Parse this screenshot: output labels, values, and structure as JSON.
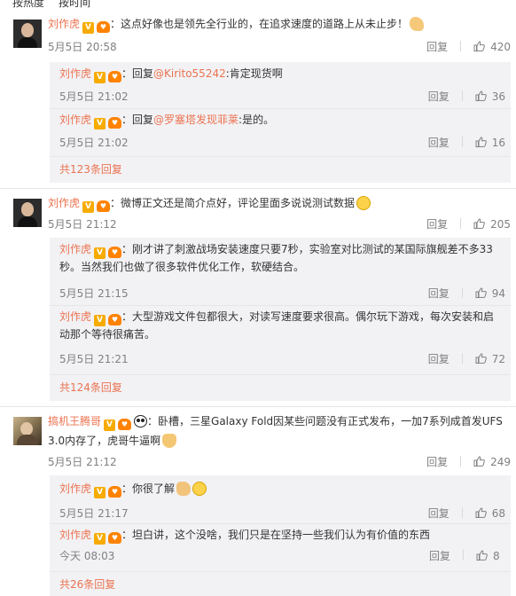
{
  "sort": {
    "hot": "按热度",
    "time": "按时间"
  },
  "actions": {
    "reply": "回复"
  },
  "comments": [
    {
      "user": "刘作虎",
      "fan": "♥",
      "text": "：这点好像也是领先全行业的，在追求速度的道路上从未止步！",
      "emoji": "flexed-arm-emoji",
      "time": "5月5日 20:58",
      "likes": "420",
      "replies": [
        {
          "user": "刘作虎",
          "fan": "♥",
          "prefix": "：回复",
          "mention": "@Kirito55242",
          "text": ":肯定现货啊",
          "time": "5月5日 21:02",
          "likes": "36"
        },
        {
          "user": "刘作虎",
          "fan": "♥",
          "prefix": "：回复",
          "mention": "@罗塞塔发现菲莱",
          "text": ":是的。",
          "time": "5月5日 21:02",
          "likes": "16"
        }
      ],
      "more": "共123条回复"
    },
    {
      "user": "刘作虎",
      "fan": "♥",
      "text": "：微博正文还是简介点好，评论里面多说说测试数据",
      "emoji": "grin-emoji",
      "time": "5月5日 21:12",
      "likes": "205",
      "replies": [
        {
          "user": "刘作虎",
          "fan": "♥",
          "text1": "：刚才讲了刺激战场安装速度只要7秒，实验室对比测试的某国际旗舰差不多33",
          "text2": "秒。当然我们也做了很多软件优化工作，软硬结合。",
          "time": "5月5日 21:15",
          "likes": "94"
        },
        {
          "user": "刘作虎",
          "fan": "♥",
          "text1": "：大型游戏文件包都很大，对读写速度要求很高。偶尔玩下游戏，每次安装和启",
          "text2": "动那个等待很痛苦。",
          "time": "5月5日 21:21",
          "likes": "72"
        }
      ],
      "more": "共124条回复"
    },
    {
      "user": "搞机王腾哥",
      "fan": "♥",
      "text1": "：卧槽，三星Galaxy Fold因某些问题没有正式发布，一加7系列成首发UFS",
      "text2": "3.0内存了，虎哥牛逼啊",
      "emoji": "praying-emoji",
      "time": "5月5日 21:12",
      "likes": "249",
      "replies": [
        {
          "user": "刘作虎",
          "fan": "♥",
          "text": "：你很了解",
          "time": "5月5日 21:17",
          "likes": "68"
        },
        {
          "user": "刘作虎",
          "fan": "♥",
          "text": "：坦白讲，这个没啥，我们只是在坚持一些我们认为有价值的东西",
          "time": "今天 08:03",
          "likes": "8"
        }
      ],
      "more": "共26条回复"
    }
  ],
  "badges": {
    "verified": "V"
  },
  "colors": {
    "username": "#eb7350",
    "meta": "#808080",
    "reply_bg": "#f2f2f5"
  }
}
